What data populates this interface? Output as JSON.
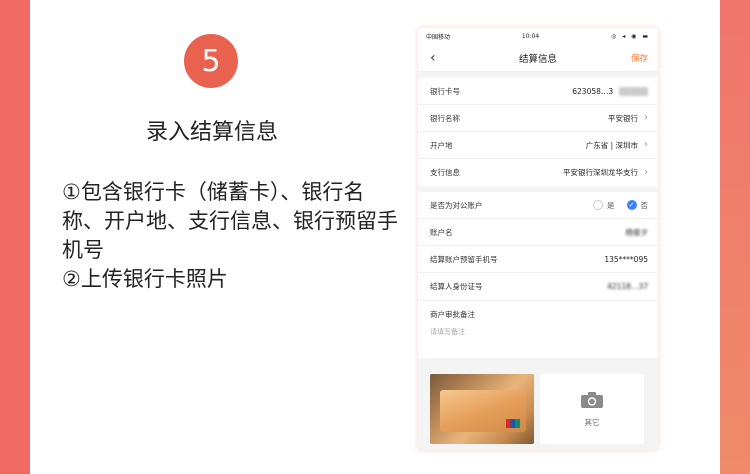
{
  "step": {
    "number": "5",
    "title": "录入结算信息"
  },
  "description": [
    "①包含银行卡（储蓄卡）、银行名称、开户地、支行信息、银行预留手机号",
    "②上传银行卡照片"
  ],
  "phone": {
    "status": {
      "carrier": "中国移动",
      "time": "10:04",
      "icons": "◎ ◂ ◉ ▬"
    },
    "nav": {
      "back": "‹",
      "title": "结算信息",
      "save": "保存"
    },
    "rows1": [
      {
        "label": "银行卡号",
        "value": "623058…3"
      },
      {
        "label": "银行名称",
        "value": "平安银行"
      },
      {
        "label": "开户地",
        "value": "广东省 | 深圳市"
      },
      {
        "label": "支行信息",
        "value": "平安银行深圳龙华支行"
      }
    ],
    "rows2": {
      "public_account": {
        "label": "是否为对公账户",
        "yes": "是",
        "no": "否"
      },
      "account_name": {
        "label": "账户名",
        "value": "杨俊夕"
      },
      "phone": {
        "label": "结算账户预留手机号",
        "value": "135****095"
      },
      "id_number": {
        "label": "结算人身份证号",
        "value": "42118…37"
      }
    },
    "memo": {
      "label": "商户审批备注",
      "placeholder": "请填写备注"
    },
    "other_label": "其它"
  }
}
